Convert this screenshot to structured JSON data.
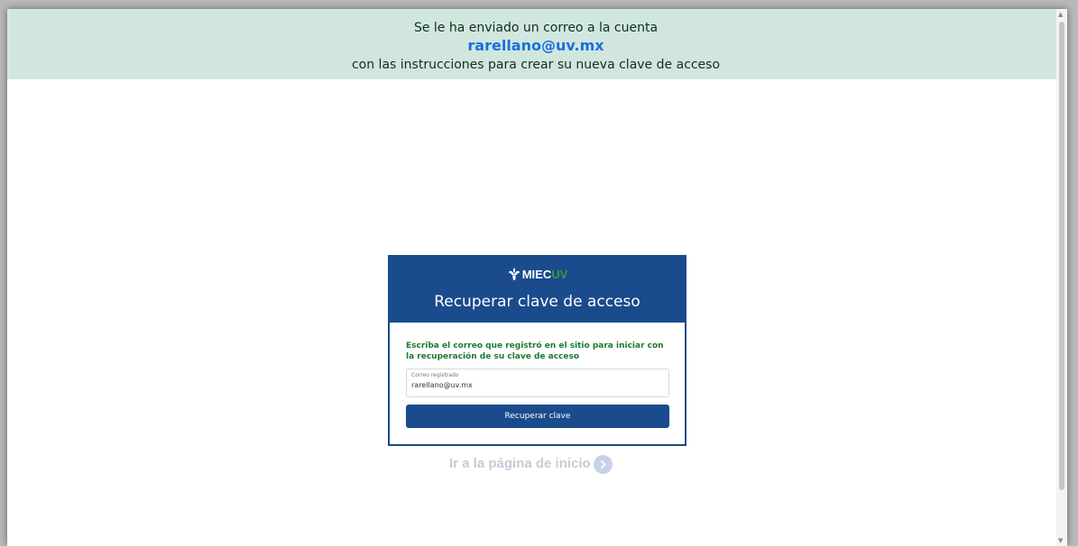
{
  "alert": {
    "line1": "Se le ha enviado un correo a la cuenta",
    "email": "rarellano@uv.mx",
    "line3": "con las instrucciones para crear su nueva clave de acceso",
    "background": "#d1e7dd"
  },
  "card": {
    "logo": {
      "miec": "MIEC",
      "uv": "UV"
    },
    "title": "Recuperar clave de acceso",
    "instructions": "Escriba el correo que registró en el sitio para iniciar con la recuperación de su clave de acceso",
    "field": {
      "label": "Correo registrado",
      "value": "rarellano@uv.mx"
    },
    "button_label": "Recuperar clave",
    "accent": "#1a4b8c"
  },
  "home_link": {
    "label": "Ir a la página de inicio",
    "icon": "chevron-right-circle-icon"
  }
}
